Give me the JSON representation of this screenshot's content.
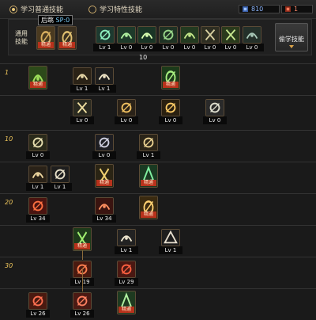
{
  "topbar": {
    "tab_normal": "学习普通技能",
    "tab_special": "学习特性技能",
    "sp_value": "810",
    "tp_value": "1",
    "colors": {
      "sp": "#6aa4ff",
      "tp": "#e45a3d"
    }
  },
  "common": {
    "label": "通用\n技能",
    "tooltip_name": "后跳",
    "tooltip_sp": "SP:0",
    "learn_button": "偷学技能",
    "page": "10",
    "slots": [
      {
        "badge": "精通",
        "icon": "backstep-icon"
      },
      {
        "badge": "精通",
        "icon": "leap-icon"
      },
      {
        "level": "Lv 1",
        "icon": "bird-icon"
      },
      {
        "level": "Lv 0",
        "icon": "cross-icon"
      },
      {
        "level": "Lv 0",
        "icon": "spark-icon"
      },
      {
        "level": "Lv 0",
        "icon": "wolf-icon"
      },
      {
        "level": "Lv 0",
        "icon": "rider-icon"
      },
      {
        "level": "Lv 0",
        "icon": "shield-icon"
      },
      {
        "level": "Lv 0",
        "icon": "muscle-icon"
      },
      {
        "level": "Lv 0",
        "icon": "smoke-icon"
      }
    ]
  },
  "tree": {
    "rows": [
      {
        "level": "1"
      },
      {
        "level": ""
      },
      {
        "level": "10"
      },
      {
        "level": ""
      },
      {
        "level": "20"
      },
      {
        "level": ""
      },
      {
        "level": "30"
      },
      {
        "level": ""
      }
    ],
    "skills": [
      {
        "row": 0,
        "badge": "精通",
        "icon": "gold-rune-icon"
      },
      {
        "row": 0,
        "level": "Lv 1",
        "icon": "slash-icon"
      },
      {
        "row": 0,
        "level": "Lv 1",
        "icon": "arc-slash-icon"
      },
      {
        "row": 0,
        "badge": "精通",
        "icon": "leaf-icon"
      },
      {
        "row": 1,
        "level": "Lv 0",
        "icon": "dagger-icon"
      },
      {
        "row": 1,
        "level": "Lv 0",
        "icon": "triple-arrow-icon"
      },
      {
        "row": 1,
        "level": "Lv 0",
        "icon": "crescent-icon"
      },
      {
        "row": 1,
        "level": "Lv 0",
        "icon": "guard-shield-icon"
      },
      {
        "row": 2,
        "level": "Lv 0",
        "icon": "fist-icon"
      },
      {
        "row": 2,
        "level": "Lv 0",
        "icon": "moon-icon"
      },
      {
        "row": 2,
        "level": "Lv 1",
        "icon": "wind-icon"
      },
      {
        "row": 3,
        "level": "Lv 1",
        "icon": "whirl-icon"
      },
      {
        "row": 3,
        "level": "Lv 1",
        "icon": "hook-icon"
      },
      {
        "row": 3,
        "badge": "精通",
        "icon": "crossed-blades-icon"
      },
      {
        "row": 3,
        "badge": "精通",
        "icon": "green-burst-icon"
      },
      {
        "row": 4,
        "level": "Lv 34",
        "icon": "red-claw-icon"
      },
      {
        "row": 4,
        "level": "Lv 34",
        "icon": "red-swirl-icon"
      },
      {
        "row": 4,
        "badge": "精通",
        "icon": "flame-figure-icon"
      },
      {
        "row": 5,
        "badge": "精通",
        "icon": "green-fury-icon"
      },
      {
        "row": 5,
        "level": "Lv 1",
        "icon": "double-strike-icon"
      },
      {
        "row": 5,
        "level": "Lv 1",
        "icon": "dark-figure-icon"
      },
      {
        "row": 6,
        "level": "Lv 19",
        "icon": "fire-orb-icon"
      },
      {
        "row": 6,
        "level": "Lv 29",
        "icon": "fire-arc-icon"
      },
      {
        "row": 7,
        "level": "Lv 26",
        "icon": "red-rune-icon"
      },
      {
        "row": 7,
        "level": "Lv 26",
        "icon": "red-dash-icon"
      },
      {
        "row": 7,
        "badge": "精通",
        "icon": "green-shard-icon"
      }
    ]
  }
}
